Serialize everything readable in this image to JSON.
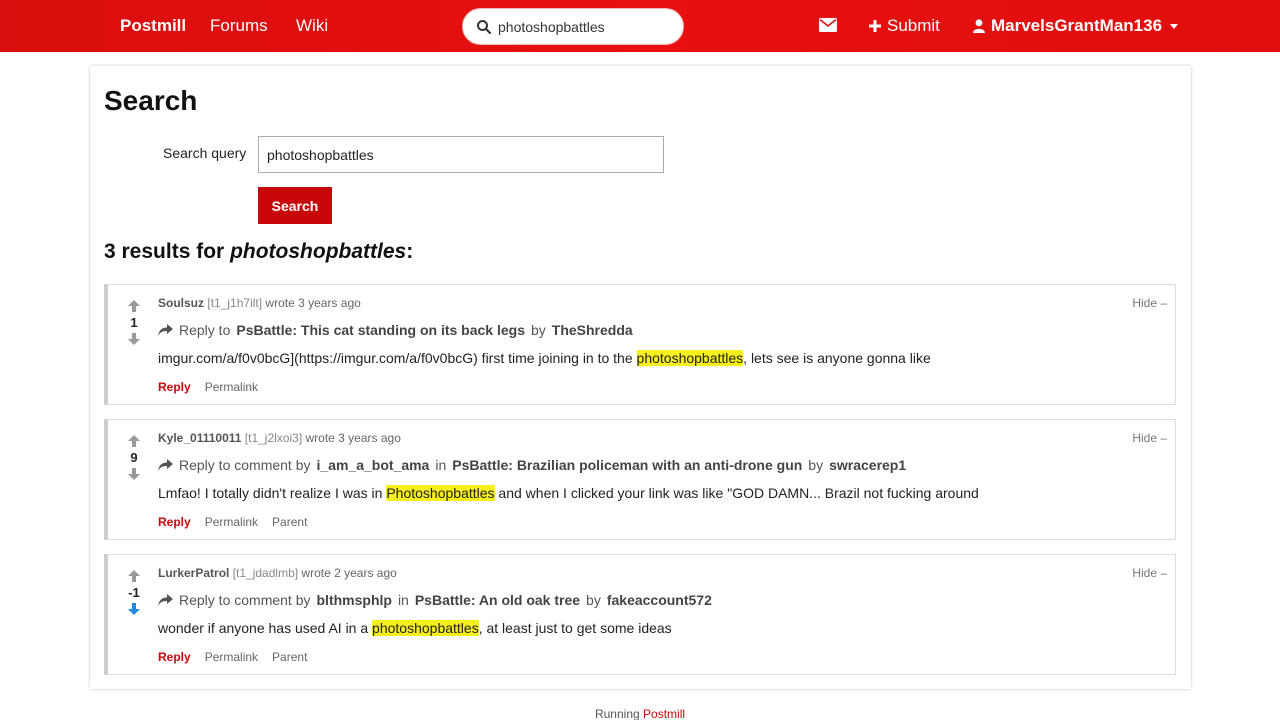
{
  "nav": {
    "brand": "Postmill",
    "forums": "Forums",
    "wiki": "Wiki",
    "search_value": "photoshopbattles",
    "submit": "Submit",
    "user": "MarvelsGrantMan136"
  },
  "main": {
    "title": "Search",
    "query_label": "Search query",
    "query_value": "photoshopbattles",
    "search_button": "Search",
    "results_prefix": "3 results for",
    "results_term": "photoshopbattles",
    "results_suffix": ":"
  },
  "comments": [
    {
      "score": "1",
      "vote_state": "none",
      "author": "Soulsuz",
      "id": "[t1_j1h7ilt]",
      "time": "wrote 3 years ago",
      "hide": "Hide –",
      "reply_prefix": "Reply to",
      "reply_to_user": "",
      "in_word": "",
      "post_title": "PsBattle: This cat standing on its back legs",
      "by_word": "by",
      "post_author": "TheShredda",
      "body_before": "imgur.com/a/f0v0bcG](https://imgur.com/a/f0v0bcG) first time joining in to the ",
      "body_highlight": "photoshopbattles",
      "body_after": ", lets see is anyone gonna like",
      "actions": [
        "Reply",
        "Permalink"
      ]
    },
    {
      "score": "9",
      "vote_state": "none",
      "author": "Kyle_01110011",
      "id": "[t1_j2lxoi3]",
      "time": "wrote 3 years ago",
      "hide": "Hide –",
      "reply_prefix": "Reply to comment by",
      "reply_to_user": "i_am_a_bot_ama",
      "in_word": "in",
      "post_title": "PsBattle: Brazilian policeman with an anti-drone gun",
      "by_word": "by",
      "post_author": "swracerep1",
      "body_before": "Lmfao! I totally didn't realize I was in ",
      "body_highlight": "Photoshopbattles",
      "body_after": " and when I clicked your link was like \"GOD DAMN... Brazil not fucking around",
      "actions": [
        "Reply",
        "Permalink",
        "Parent"
      ]
    },
    {
      "score": "-1",
      "vote_state": "down",
      "author": "LurkerPatrol",
      "id": "[t1_jdadlmb]",
      "time": "wrote 2 years ago",
      "hide": "Hide –",
      "reply_prefix": "Reply to comment by",
      "reply_to_user": "blthmsphlp",
      "in_word": "in",
      "post_title": "PsBattle: An old oak tree",
      "by_word": "by",
      "post_author": "fakeaccount572",
      "body_before": "wonder if anyone has used AI in a ",
      "body_highlight": "photoshopbattles",
      "body_after": ", at least just to get some ideas",
      "actions": [
        "Reply",
        "Permalink",
        "Parent"
      ]
    }
  ],
  "footer": {
    "prefix": "Running",
    "brand": "Postmill"
  },
  "colors": {
    "brand_red": "#c8070b",
    "highlight": "#f6ef1c",
    "downvote": "#1e88e5"
  }
}
